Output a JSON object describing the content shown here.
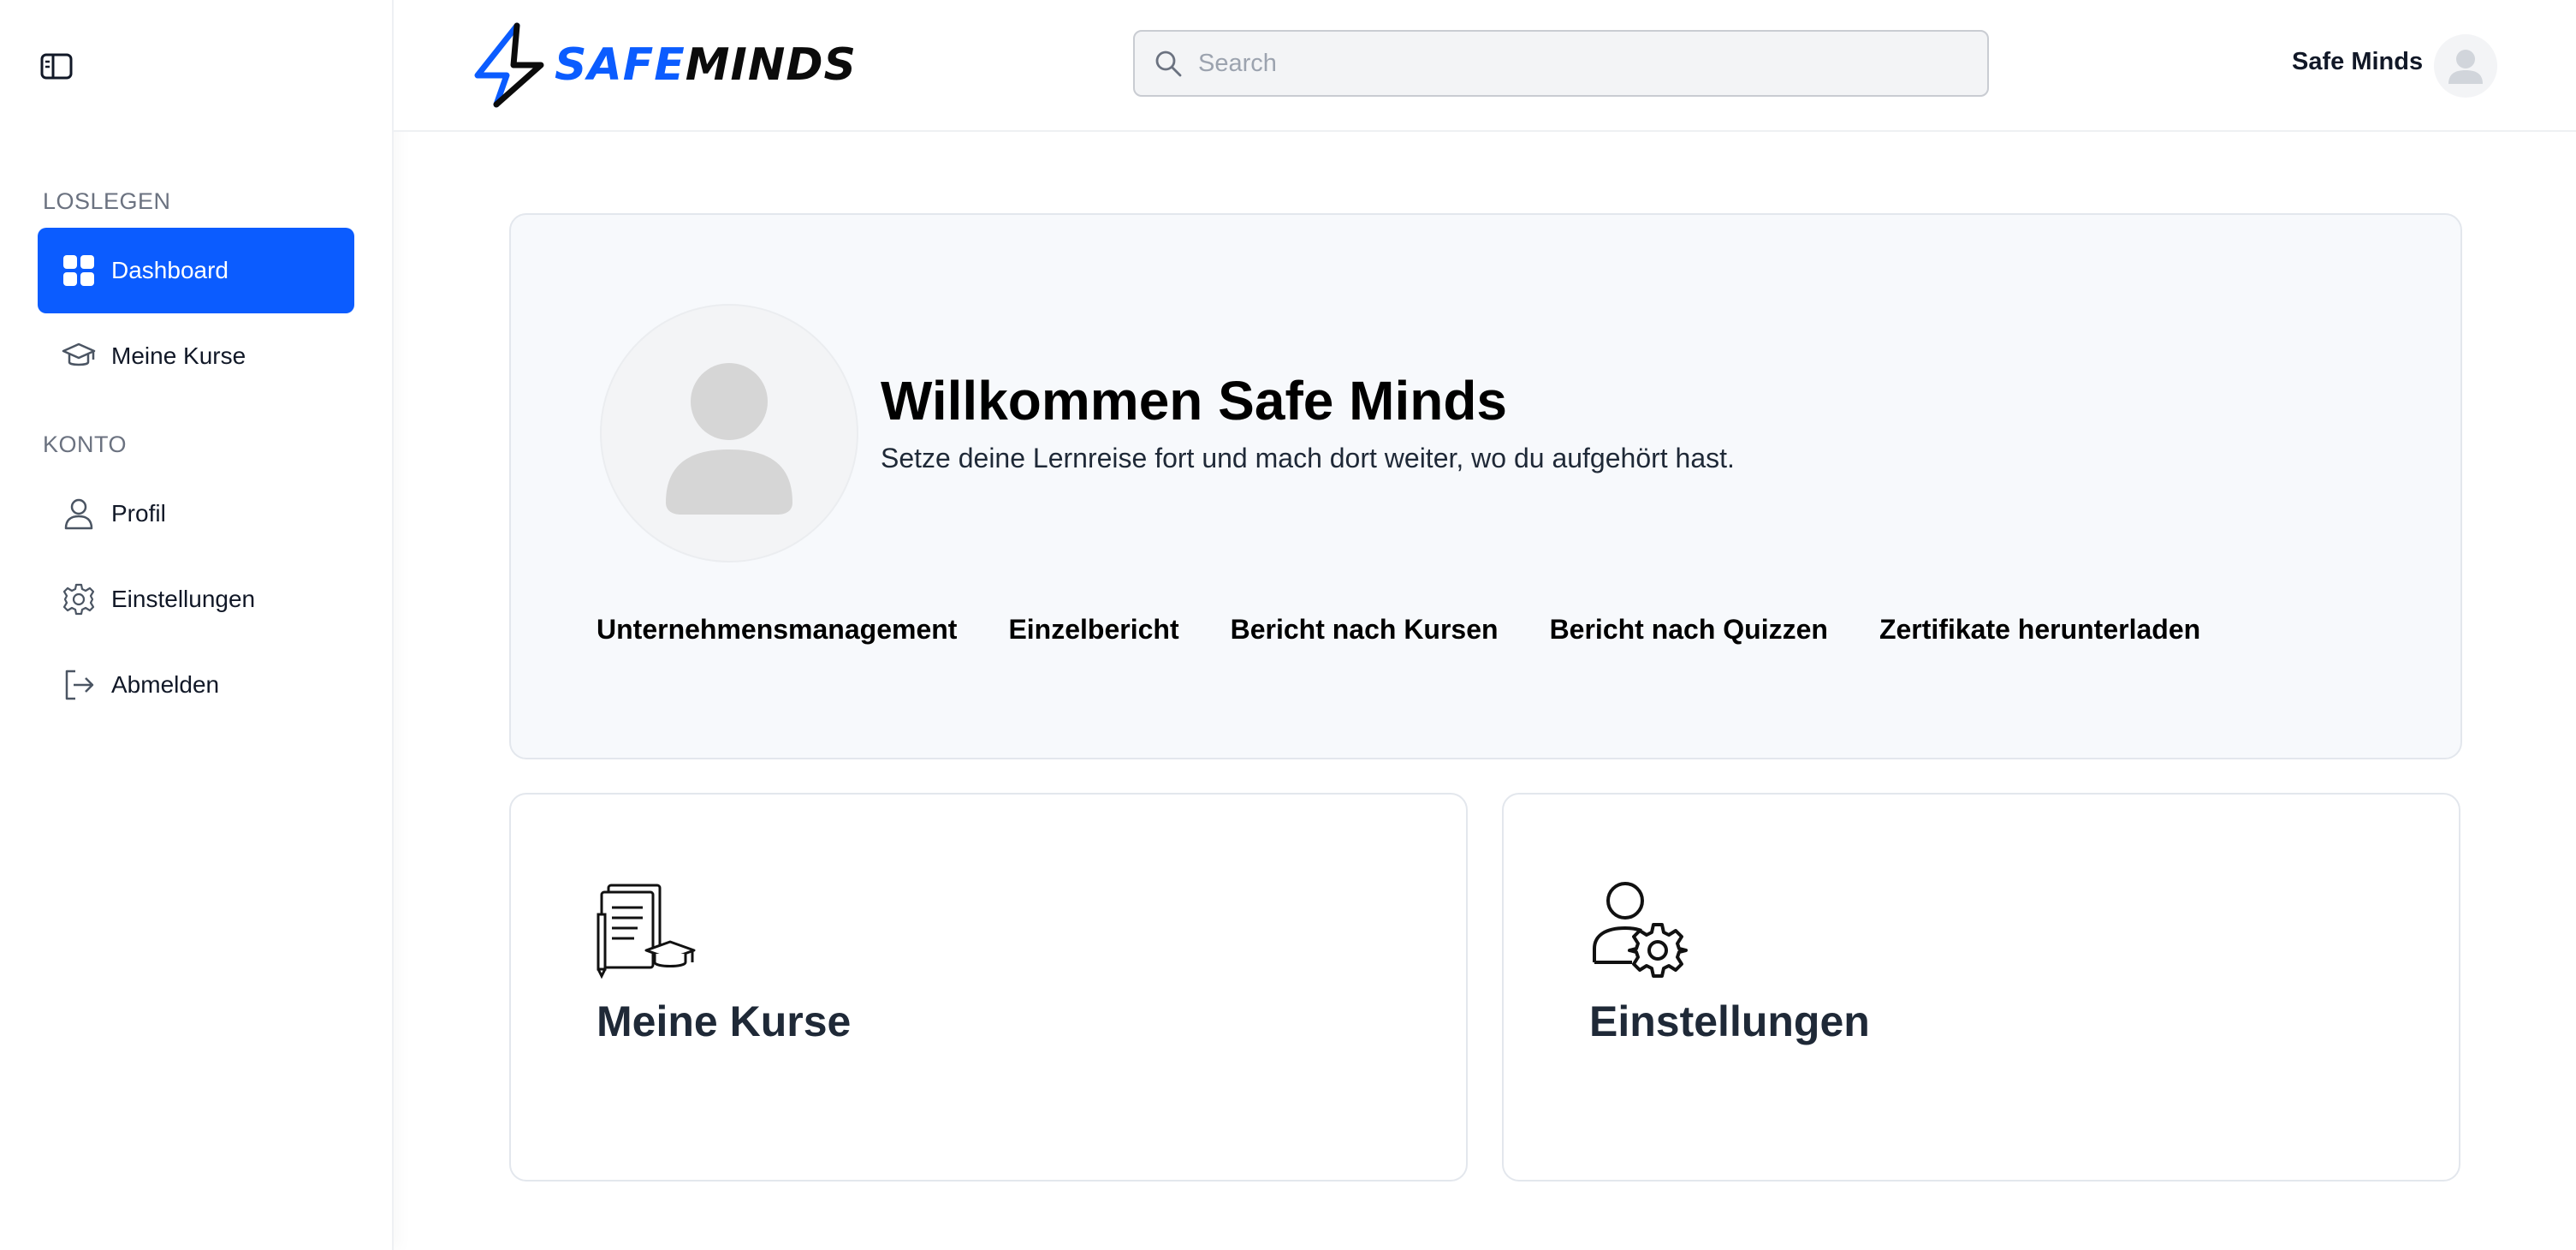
{
  "sidebar": {
    "toggle_icon": "sidebar-toggle-icon",
    "sections": [
      {
        "label": "LOSLEGEN",
        "items": [
          {
            "label": "Dashboard",
            "icon": "grid-icon",
            "active": true
          },
          {
            "label": "Meine Kurse",
            "icon": "graduation-cap-icon",
            "active": false
          }
        ]
      },
      {
        "label": "KONTO",
        "items": [
          {
            "label": "Profil",
            "icon": "user-icon",
            "active": false
          },
          {
            "label": "Einstellungen",
            "icon": "gear-icon",
            "active": false
          },
          {
            "label": "Abmelden",
            "icon": "logout-icon",
            "active": false
          }
        ]
      }
    ]
  },
  "header": {
    "logo": {
      "part1": "SAFE",
      "part2": "MINDS"
    },
    "search": {
      "placeholder": "Search",
      "value": ""
    },
    "user": {
      "name": "Safe Minds"
    }
  },
  "welcome": {
    "title": "Willkommen Safe Minds",
    "subtitle": "Setze deine Lernreise fort und mach dort weiter, wo du aufgehört hast.",
    "links": [
      "Unternehmensmanagement",
      "Einzelbericht",
      "Bericht nach Kursen",
      "Bericht nach Quizzen",
      "Zertifikate herunterladen"
    ]
  },
  "cards": [
    {
      "title": "Meine Kurse",
      "icon": "courses-icon"
    },
    {
      "title": "Einstellungen",
      "icon": "user-settings-icon"
    }
  ],
  "colors": {
    "accent": "#0b5cff",
    "text": "#111827",
    "muted": "#6b7280",
    "card_bg": "#f7f9fc",
    "border": "#e3e7ed"
  }
}
